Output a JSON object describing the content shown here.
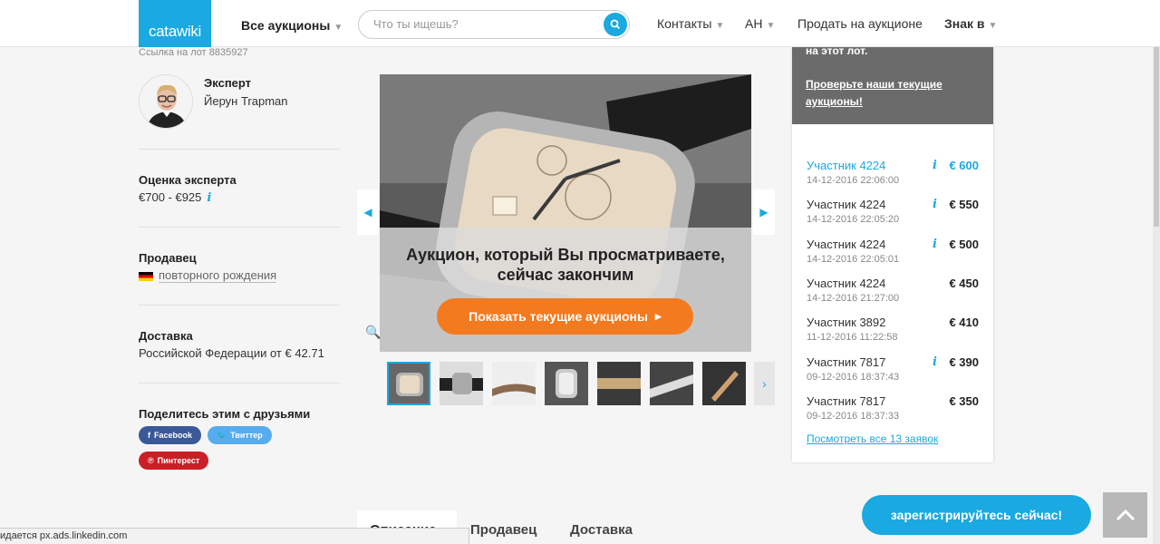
{
  "header": {
    "logo": "catawiki",
    "all_auctions": "Все аукционы",
    "search_placeholder": "Что ты ищешь?",
    "contacts": "Контакты",
    "language": "АН",
    "sell": "Продать на аукционе",
    "sign_in": "Знак в"
  },
  "lot_link": "Ссылка на лот 8835927",
  "expert": {
    "title": "Эксперт",
    "name": "Йерун Trapman"
  },
  "estimate": {
    "title": "Оценка эксперта",
    "value": "€700 - €925"
  },
  "seller": {
    "title": "Продавец",
    "name": "повторного рождения"
  },
  "delivery": {
    "title": "Доставка",
    "text": "Российской Федерации от € 42.71"
  },
  "share": {
    "title": "Поделитесь этим с друзьями",
    "facebook": "Facebook",
    "twitter": "Твиттер",
    "pinterest": "Пинтерест"
  },
  "gallery": {
    "overlay_text": "Аукцион, который Вы просматриваете, сейчас закончим",
    "cta": "Показать текущие аукционы"
  },
  "panel": {
    "cut_text": "на этот лот.",
    "link": "Проверьте наши текущие аукционы!",
    "bids": [
      {
        "name": "Участник 4224",
        "date": "14-12-2016 22:06:00",
        "amount": "€ 600"
      },
      {
        "name": "Участник 4224",
        "date": "14-12-2016 22:05:20",
        "amount": "€ 550"
      },
      {
        "name": "Участник 4224",
        "date": "14-12-2016 22:05:01",
        "amount": "€ 500"
      },
      {
        "name": "Участник 4224",
        "date": "14-12-2016 21:27:00",
        "amount": "€ 450"
      },
      {
        "name": "Участник 3892",
        "date": "11-12-2016 11:22:58",
        "amount": "€ 410"
      },
      {
        "name": "Участник 7817",
        "date": "09-12-2016 18:37:43",
        "amount": "€ 390"
      },
      {
        "name": "Участник 7817",
        "date": "09-12-2016 18:37:33",
        "amount": "€ 350"
      }
    ],
    "see_all": "Посмотреть все 13 заявок"
  },
  "tabs": {
    "description": "Описание",
    "seller": "Продавец",
    "delivery": "Доставка"
  },
  "register": "зарегистрируйтесь сейчас!",
  "status_bar": "идается px.ads.linkedin.com",
  "colors": {
    "brand": "#1aa9e0",
    "cta": "#f47a20",
    "pinterest": "#cb1f27",
    "facebook": "#3b5998",
    "twitter": "#55acee"
  }
}
